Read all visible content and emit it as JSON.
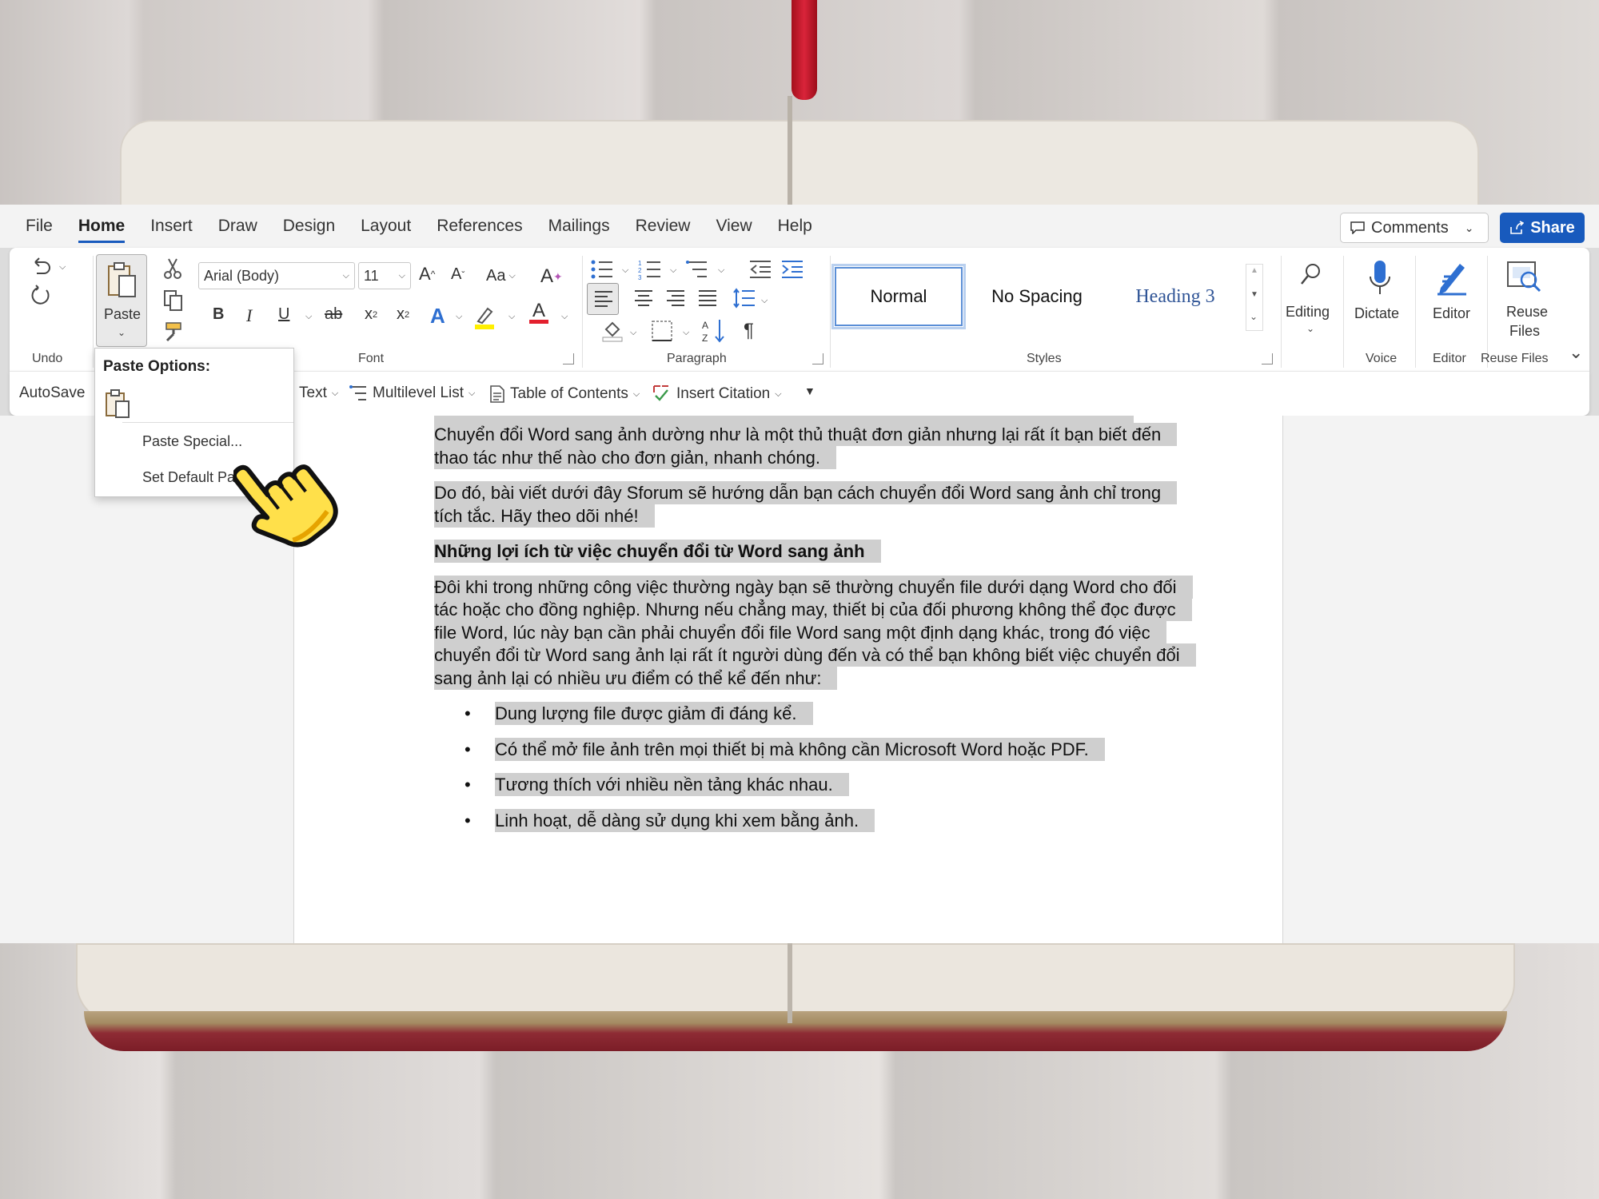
{
  "menu": {
    "tabs": [
      "File",
      "Home",
      "Insert",
      "Draw",
      "Design",
      "Layout",
      "References",
      "Mailings",
      "Review",
      "View",
      "Help"
    ],
    "active_tab": "Home",
    "comments_label": "Comments",
    "share_label": "Share"
  },
  "ribbon": {
    "undo_group": "Undo",
    "paste_label": "Paste",
    "font_name": "Arial (Body)",
    "font_size": "11",
    "case_label": "Aa",
    "font_group": "Font",
    "paragraph_group": "Paragraph",
    "styles": [
      "Normal",
      "No Spacing",
      "Heading 3"
    ],
    "selected_style": "Normal",
    "styles_group": "Styles",
    "editing_label": "Editing",
    "dictate_label": "Dictate",
    "voice_group": "Voice",
    "editor_label": "Editor",
    "editor_group": "Editor",
    "reuse_label_1": "Reuse",
    "reuse_label_2": "Files",
    "reuse_group": "Reuse Files"
  },
  "qat": {
    "autosave": "AutoSave",
    "text": "Text",
    "multilevel": "Multilevel List",
    "toc": "Table of Contents",
    "citation": "Insert Citation"
  },
  "paste_menu": {
    "title": "Paste Options:",
    "paste_special": "Paste Special...",
    "set_default": "Set Default Paste"
  },
  "document": {
    "p1": "Chuyển đổi Word sang ảnh dường như là một thủ thuật đơn giản nhưng lại rất ít bạn biết đến thao tác như thế nào cho đơn giản, nhanh chóng.",
    "p2": "Do đó, bài viết dưới đây Sforum sẽ hướng dẫn bạn cách chuyển đổi Word sang ảnh chỉ trong tích tắc. Hãy theo dõi nhé!",
    "heading": "Những lợi ích từ việc chuyển đổi từ Word sang ảnh",
    "p3": "Đôi khi trong những công việc thường ngày bạn sẽ thường chuyển file dưới dạng Word cho đối tác hoặc cho đồng nghiệp. Nhưng nếu chẳng may, thiết bị của đối phương không thể đọc được file Word, lúc này bạn cần phải chuyển đổi file Word sang một định dạng khác, trong đó việc chuyển đổi từ Word sang ảnh lại rất ít người dùng đến và có thể bạn không biết việc chuyển đổi sang ảnh lại có nhiều ưu điểm có thể kể đến như:",
    "bullets": [
      "Dung lượng file được giảm đi đáng kể.",
      "Có thể mở file ảnh trên mọi thiết bị mà không cần Microsoft Word hoặc PDF.",
      "Tương thích với nhiều nền tảng khác nhau.",
      "Linh hoạt, dễ dàng sử dụng khi xem bằng ảnh."
    ],
    "bullet_glyph": "•"
  },
  "colors": {
    "accent": "#185abd",
    "selection": "#cfcfcf"
  },
  "icons": [
    "undo-icon",
    "redo-icon",
    "cut-icon",
    "copy-icon",
    "format-painter-icon",
    "search-icon",
    "microphone-icon",
    "editor-pen-icon",
    "reuse-files-icon",
    "hand-pointer-icon"
  ]
}
